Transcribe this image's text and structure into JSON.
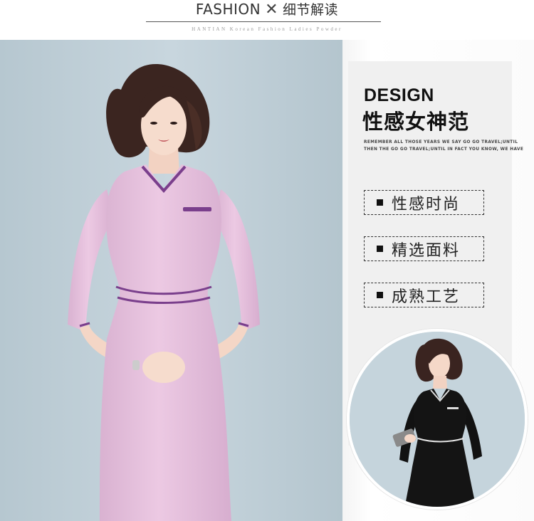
{
  "header": {
    "title_main": "FASHION",
    "title_sep": "✕",
    "title_sub": "细节解读",
    "tagline": "HANTIAN  Korean Fashion Ladies Powder"
  },
  "design": {
    "title": "DESIGN",
    "subtitle": "性感女神范",
    "small_line_1": "REMEMBER ALL THOSE YEARS WE SAY GO GO TRAVEL;UNTIL",
    "small_line_2": "THEN THE GO GO TRAVEL;UNTIL  IN FACT YOU KNOW, WE HAVE"
  },
  "features": [
    {
      "label": "性感时尚"
    },
    {
      "label": "精选面料"
    },
    {
      "label": "成熟工艺"
    }
  ],
  "colors": {
    "dress_main": "#e6c3de",
    "piping": "#7a3f8c",
    "inset_dress": "#141414",
    "background_blue": "#c2d2db"
  }
}
